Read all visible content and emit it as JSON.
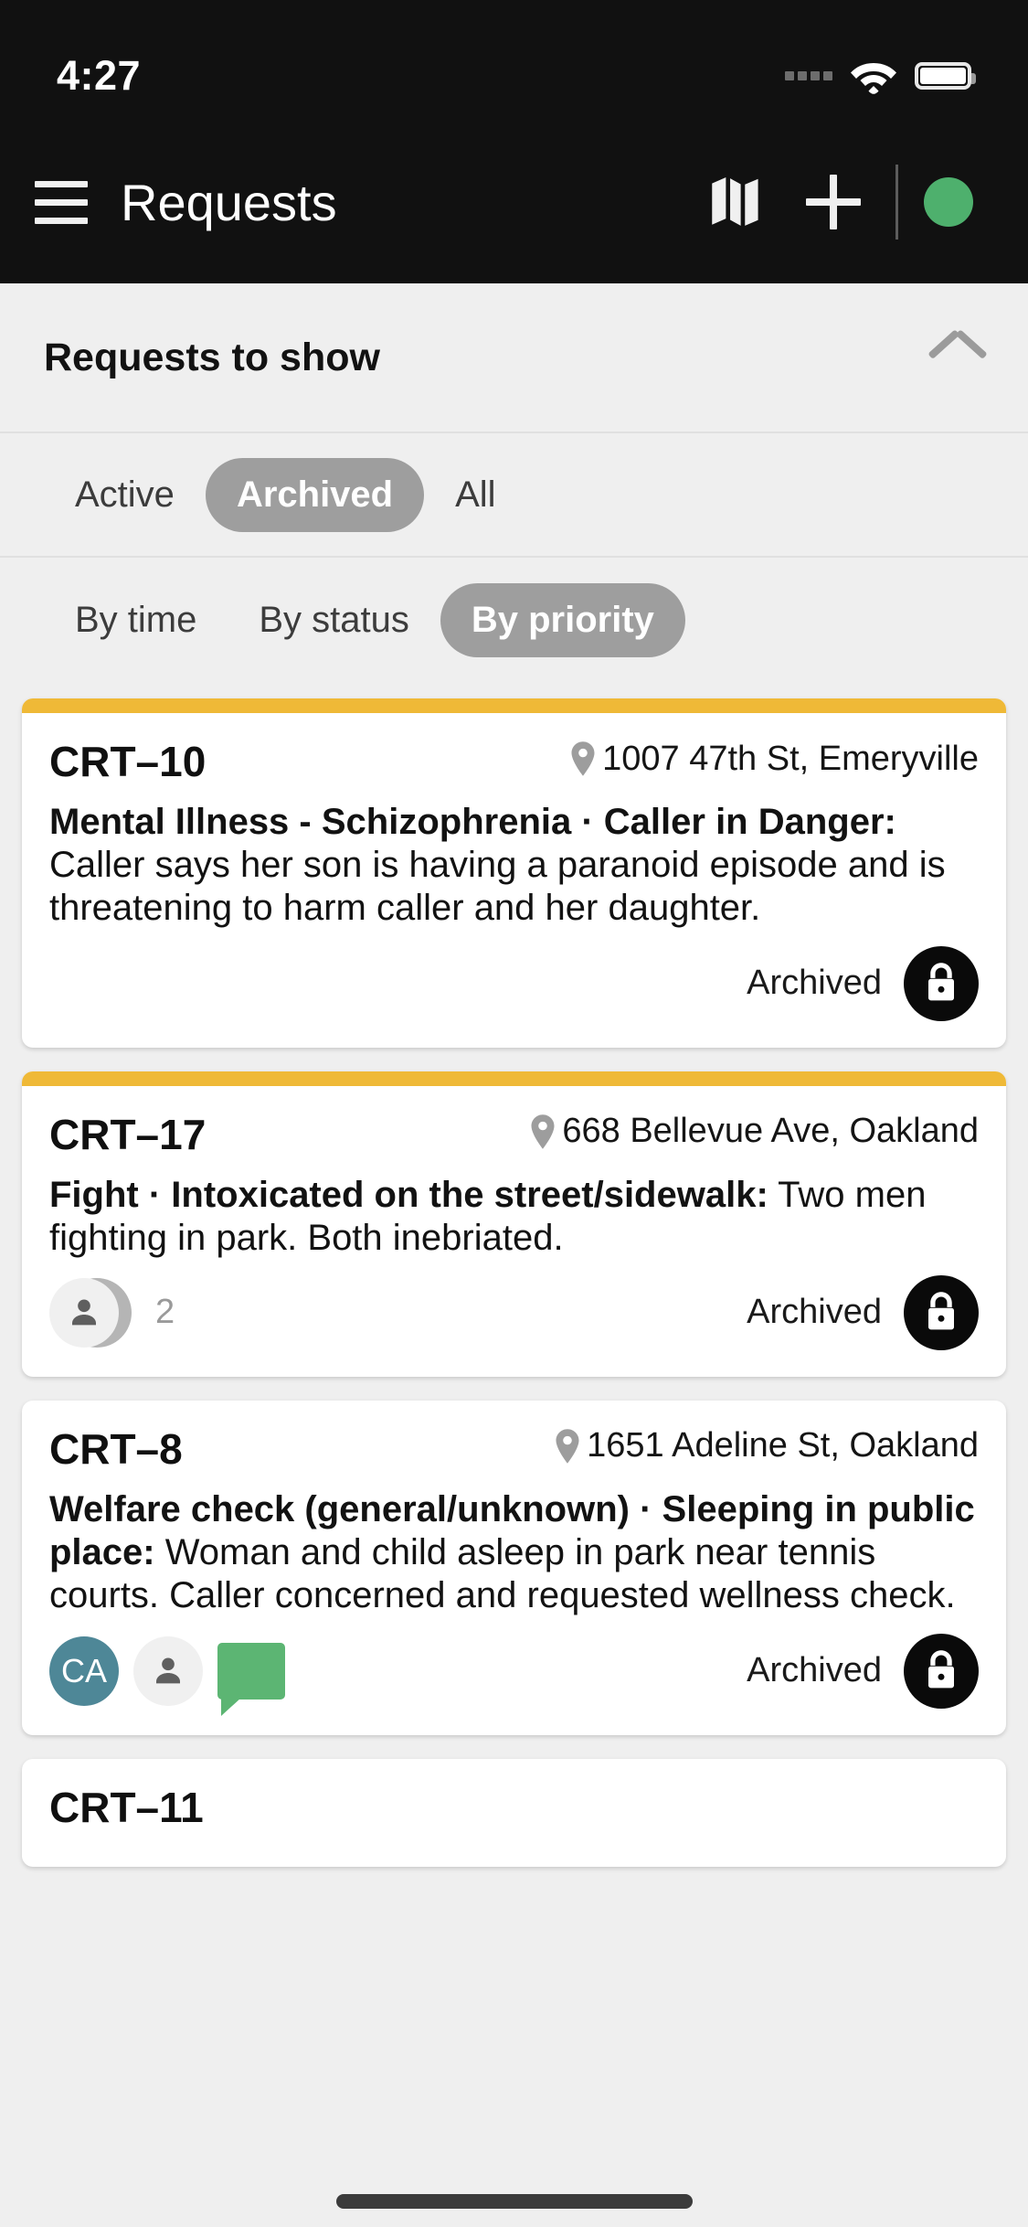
{
  "status_bar": {
    "time": "4:27",
    "signal_icon": "signal-dots-icon",
    "wifi_icon": "wifi-icon",
    "battery_icon": "battery-icon"
  },
  "app_bar": {
    "menu_icon": "hamburger-menu-icon",
    "title": "Requests",
    "map_icon": "map-icon",
    "add_icon": "plus-icon",
    "status_dot_color": "#4eb06d"
  },
  "filter_panel": {
    "title": "Requests to show",
    "collapse_icon": "chevron-up-icon",
    "state_filters": [
      {
        "label": "Active",
        "selected": false
      },
      {
        "label": "Archived",
        "selected": true
      },
      {
        "label": "All",
        "selected": false
      }
    ],
    "sort_filters": [
      {
        "label": "By time",
        "selected": false
      },
      {
        "label": "By status",
        "selected": false
      },
      {
        "label": "By priority",
        "selected": true
      }
    ]
  },
  "colors": {
    "accent_priority": "#efb937",
    "status_online": "#4eb06d",
    "chat_green": "#5cb573",
    "avatar_teal": "#4e8797",
    "chip_selected": "#9e9e9e"
  },
  "cards": [
    {
      "id": "CRT–10",
      "accent": true,
      "location": "1007 47th St, Emeryville",
      "location_icon": "map-pin-icon",
      "title": "Mental Illness - Schizophrenia · Caller in Danger:",
      "description": " Caller says her son is having a paranoid episode and is threatening to harm caller and her daughter.",
      "badges": [],
      "status_label": "Archived",
      "status_icon": "lock-icon"
    },
    {
      "id": "CRT–17",
      "accent": true,
      "location": "668 Bellevue Ave, Oakland",
      "location_icon": "map-pin-icon",
      "title": "Fight · Intoxicated on the street/sidewalk:",
      "description": " Two men fighting in park. Both inebriated.",
      "badges": [
        {
          "type": "avatar-stack",
          "icon": "person-icon",
          "count": "2"
        }
      ],
      "status_label": "Archived",
      "status_icon": "lock-icon"
    },
    {
      "id": "CRT–8",
      "accent": false,
      "location": "1651 Adeline St, Oakland",
      "location_icon": "map-pin-icon",
      "title": "Welfare check (general/unknown) · Sleeping in public place:",
      "description": " Woman and child asleep in park near tennis courts. Caller concerned and requested wellness check.",
      "badges": [
        {
          "type": "initials",
          "initials": "CA"
        },
        {
          "type": "avatar",
          "icon": "person-icon"
        },
        {
          "type": "chat",
          "icon": "chat-bubble-icon"
        }
      ],
      "status_label": "Archived",
      "status_icon": "lock-icon"
    },
    {
      "id": "CRT–11",
      "accent": false,
      "location": "",
      "location_icon": "map-pin-icon",
      "title": "",
      "description": "",
      "badges": [],
      "status_label": "",
      "status_icon": "lock-icon"
    }
  ]
}
